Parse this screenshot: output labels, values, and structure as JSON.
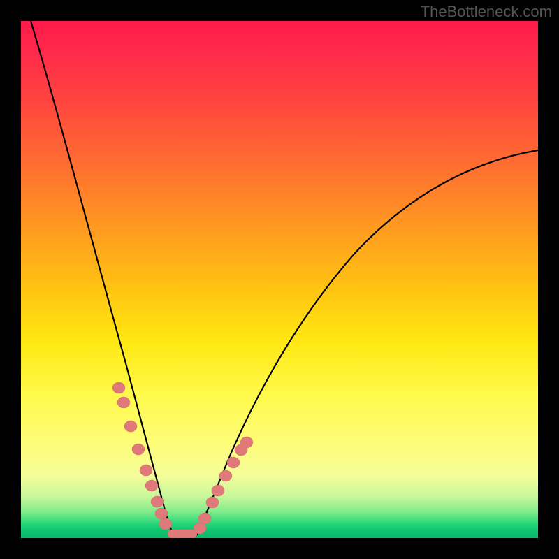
{
  "watermark": "TheBottleneck.com",
  "chart_data": {
    "type": "line",
    "title": "",
    "xlabel": "",
    "ylabel": "",
    "xlim": [
      0,
      100
    ],
    "ylim": [
      0,
      100
    ],
    "grid": false,
    "legend": false,
    "background": "red-yellow-green vertical gradient",
    "series": [
      {
        "name": "left-curve",
        "x": [
          2,
          5,
          8,
          11,
          14,
          17,
          20,
          22,
          24,
          25.5,
          27,
          28,
          29
        ],
        "values": [
          100,
          86,
          72,
          59,
          47,
          36,
          26,
          19,
          12,
          8,
          4.5,
          2,
          0.5
        ]
      },
      {
        "name": "right-curve",
        "x": [
          34,
          36,
          38,
          41,
          45,
          50,
          56,
          62,
          70,
          78,
          86,
          94,
          100
        ],
        "values": [
          0.5,
          3,
          7,
          13,
          21,
          30,
          39,
          47,
          55,
          62,
          67.5,
          72,
          75
        ]
      }
    ],
    "annotations": {
      "beads_left": [
        {
          "x": 18.5,
          "y": 29
        },
        {
          "x": 19.5,
          "y": 26
        },
        {
          "x": 21.0,
          "y": 21.5
        },
        {
          "x": 22.5,
          "y": 17
        },
        {
          "x": 24.0,
          "y": 13
        },
        {
          "x": 25.0,
          "y": 10
        },
        {
          "x": 26.2,
          "y": 7
        },
        {
          "x": 27.0,
          "y": 4.5
        },
        {
          "x": 27.8,
          "y": 2.5
        }
      ],
      "beads_right": [
        {
          "x": 34.5,
          "y": 1.5
        },
        {
          "x": 35.5,
          "y": 3.5
        },
        {
          "x": 37.0,
          "y": 6.5
        },
        {
          "x": 38.0,
          "y": 9
        },
        {
          "x": 39.5,
          "y": 12
        },
        {
          "x": 41.0,
          "y": 14.5
        },
        {
          "x": 42.5,
          "y": 17
        },
        {
          "x": 43.5,
          "y": 18.5
        }
      ],
      "bottom_pill": {
        "x_center": 31.5,
        "y": 0.5,
        "width": 5
      }
    }
  }
}
